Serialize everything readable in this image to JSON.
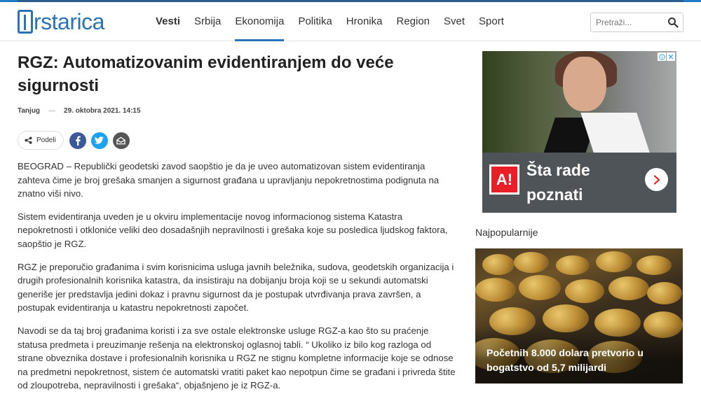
{
  "brand": {
    "logo_text": "rstarica"
  },
  "nav": {
    "items": [
      {
        "label": "Vesti"
      },
      {
        "label": "Srbija"
      },
      {
        "label": "Ekonomija"
      },
      {
        "label": "Politika"
      },
      {
        "label": "Hronika"
      },
      {
        "label": "Region"
      },
      {
        "label": "Svet"
      },
      {
        "label": "Sport"
      }
    ],
    "active": "Ekonomija"
  },
  "search": {
    "placeholder": "Pretraži...",
    "icon": "search-icon"
  },
  "article": {
    "title": "RGZ: Automatizovanim evidentiranjem do veće sigurnosti",
    "source": "Tanjug",
    "date": "29. oktobra 2021. 14:15",
    "share_label": "Podeli",
    "paragraphs": [
      "BEOGRAD – Republički geodetski zavod saopštio je da je uveo automatizovan sistem evidentiranja zahteva čime je broj grešaka smanjen a sigurnost građana u upravljanju nepokretnostima podignuta na znatno viši nivo.",
      "Sistem evidentiranja uveden je u okviru implementacije novog informacionog sistema Katastra nepokretnosti i otkloniće veliki deo dosadašnjih nepravilnosti i grešaka koje su posledica ljudskog faktora, saopštio je RGZ.",
      "RGZ je preporučio građanima i svim korisnicima usluga javnih beležnika, sudova, geodetskih organizacija i drugih profesionalnih korisnika katastra, da insistiraju na dobijanju broja koji se u sekundi automatski generiše jer predstavlja jedini dokaz i pravnu sigurnost da je postupak utvrđivanja prava završen, a postupak evidentiranja u katastru nepokretnosti započet.",
      "Navodi se da taj broj građanima koristi i za sve ostale elektronske usluge RGZ-a kao što su praćenje statusa predmeta i preuzimanje rešenja na elektronskoj oglasnoj tabli. “ Ukoliko iz bilo kog razloga od strane obveznika dostave i profesionalnih korisnika u RGZ ne stignu kompletne informacije koje se odnose na predmetni nepokretnost, sistem će automatski vratiti paket kao nepotpun čime se građani i privreda štite od zloupotreba, nepravilnosti i grešaka“, objašnjeno je iz RGZ-a."
    ]
  },
  "ad": {
    "logo_text": "A!",
    "headline": "Šta rade poznati"
  },
  "popular": {
    "heading": "Najpopularnije",
    "items": [
      {
        "title": "Početnih 8.000 dolara pretvorio u bogatstvo od 5,7 milijardi"
      }
    ]
  },
  "colors": {
    "accent": "#2a73b8",
    "facebook": "#3b5998",
    "twitter": "#1da1f2",
    "ad_red": "#e81f26"
  }
}
